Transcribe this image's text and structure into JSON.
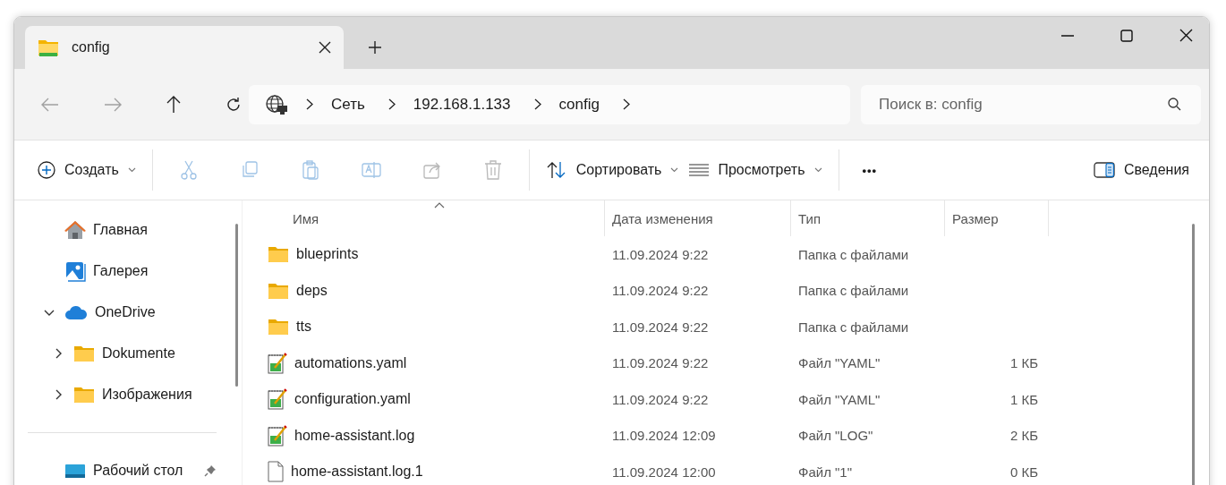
{
  "tabs": [
    {
      "title": "config",
      "selected": true
    }
  ],
  "nav_buttons": [
    {
      "kind": "back",
      "disabled": true
    },
    {
      "kind": "forward",
      "disabled": true
    },
    {
      "kind": "up",
      "disabled": false
    },
    {
      "kind": "refresh",
      "disabled": false
    }
  ],
  "breadcrumbs": [
    "Сеть",
    "192.168.1.133",
    "config"
  ],
  "search": {
    "placeholder": "Поиск в: config"
  },
  "toolbar": {
    "create": "Создать",
    "actions": [
      {
        "kind": "cut",
        "disabled": true
      },
      {
        "kind": "copy",
        "disabled": true
      },
      {
        "kind": "paste",
        "disabled": true
      },
      {
        "kind": "rename",
        "disabled": true
      },
      {
        "kind": "share",
        "disabled": true
      },
      {
        "kind": "delete",
        "disabled": true
      }
    ],
    "sort": "Сортировать",
    "view": "Просмотреть",
    "more": "•••",
    "details": "Сведения"
  },
  "sidebar": {
    "items": [
      {
        "label": "Главная",
        "kind": "home"
      },
      {
        "label": "Галерея",
        "kind": "gallery"
      },
      {
        "label": "OneDrive",
        "kind": "cloud",
        "expanded": true,
        "children": [
          {
            "label": "Dokumente",
            "kind": "folder",
            "expanded": false
          },
          {
            "label": "Изображения",
            "kind": "folder",
            "expanded": false
          }
        ]
      }
    ],
    "pinned": [
      {
        "label": "Рабочий стол",
        "kind": "desktop",
        "pinned": true
      }
    ]
  },
  "table": {
    "columns": [
      {
        "label": "Имя",
        "sorted": true
      },
      {
        "label": "Дата изменения",
        "sorted": false
      },
      {
        "label": "Тип",
        "sorted": false
      },
      {
        "label": "Размер",
        "sorted": false
      }
    ],
    "rows": [
      {
        "kind": "folder",
        "name": "blueprints",
        "date": "11.09.2024 9:22",
        "type": "Папка с файлами",
        "size": ""
      },
      {
        "kind": "folder",
        "name": "deps",
        "date": "11.09.2024 9:22",
        "type": "Папка с файлами",
        "size": ""
      },
      {
        "kind": "folder",
        "name": "tts",
        "date": "11.09.2024 9:22",
        "type": "Папка с файлами",
        "size": ""
      },
      {
        "kind": "text",
        "name": "automations.yaml",
        "date": "11.09.2024 9:22",
        "type": "Файл \"YAML\"",
        "size": "1 КБ"
      },
      {
        "kind": "text",
        "name": "configuration.yaml",
        "date": "11.09.2024 9:22",
        "type": "Файл \"YAML\"",
        "size": "1 КБ"
      },
      {
        "kind": "text",
        "name": "home-assistant.log",
        "date": "11.09.2024 12:09",
        "type": "Файл \"LOG\"",
        "size": "2 КБ"
      },
      {
        "kind": "file",
        "name": "home-assistant.log.1",
        "date": "11.09.2024 12:00",
        "type": "Файл \"1\"",
        "size": "0 КБ"
      }
    ]
  }
}
